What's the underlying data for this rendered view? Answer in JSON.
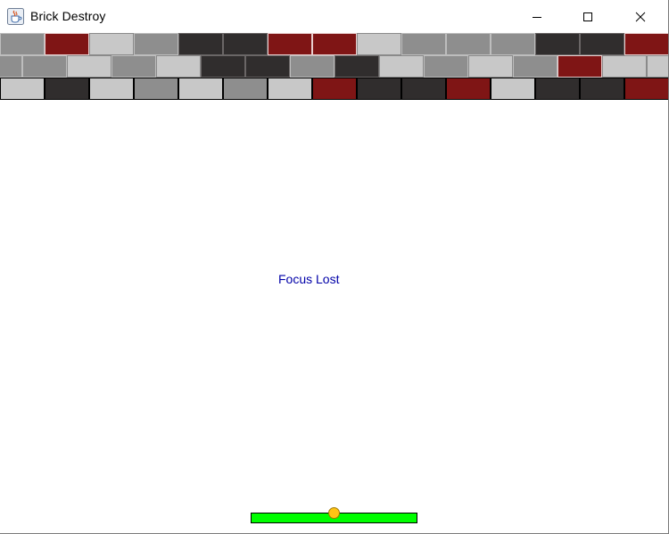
{
  "window": {
    "title": "Brick Destroy",
    "icons": {
      "app": "java-cup-icon",
      "minimize": "minimize-icon",
      "maximize": "maximize-icon",
      "close": "close-icon"
    }
  },
  "game": {
    "message": "Focus Lost",
    "message_color": "#0000a8",
    "paddle_color": "#00ff00",
    "ball_color": "#ffc414",
    "brick_colors": {
      "clay": "#7f1515",
      "steel": "#8e8e8e",
      "cement": "#c8c8c8",
      "dark": "#302d2d"
    },
    "bricks": {
      "rows": [
        [
          "steel",
          "clay",
          "cement",
          "steel",
          "dark",
          "dark",
          "clay",
          "clay",
          "cement",
          "steel",
          "steel",
          "steel",
          "dark",
          "dark",
          "clay"
        ],
        [
          "steel",
          "steel",
          "cement",
          "steel",
          "cement",
          "dark",
          "dark",
          "steel",
          "dark",
          "cement",
          "steel",
          "cement",
          "steel",
          "clay",
          "cement",
          "cement"
        ],
        [
          "cement",
          "dark",
          "cement",
          "steel",
          "cement",
          "steel",
          "cement",
          "clay",
          "dark",
          "dark",
          "clay",
          "cement",
          "dark",
          "dark",
          "clay"
        ]
      ]
    }
  }
}
